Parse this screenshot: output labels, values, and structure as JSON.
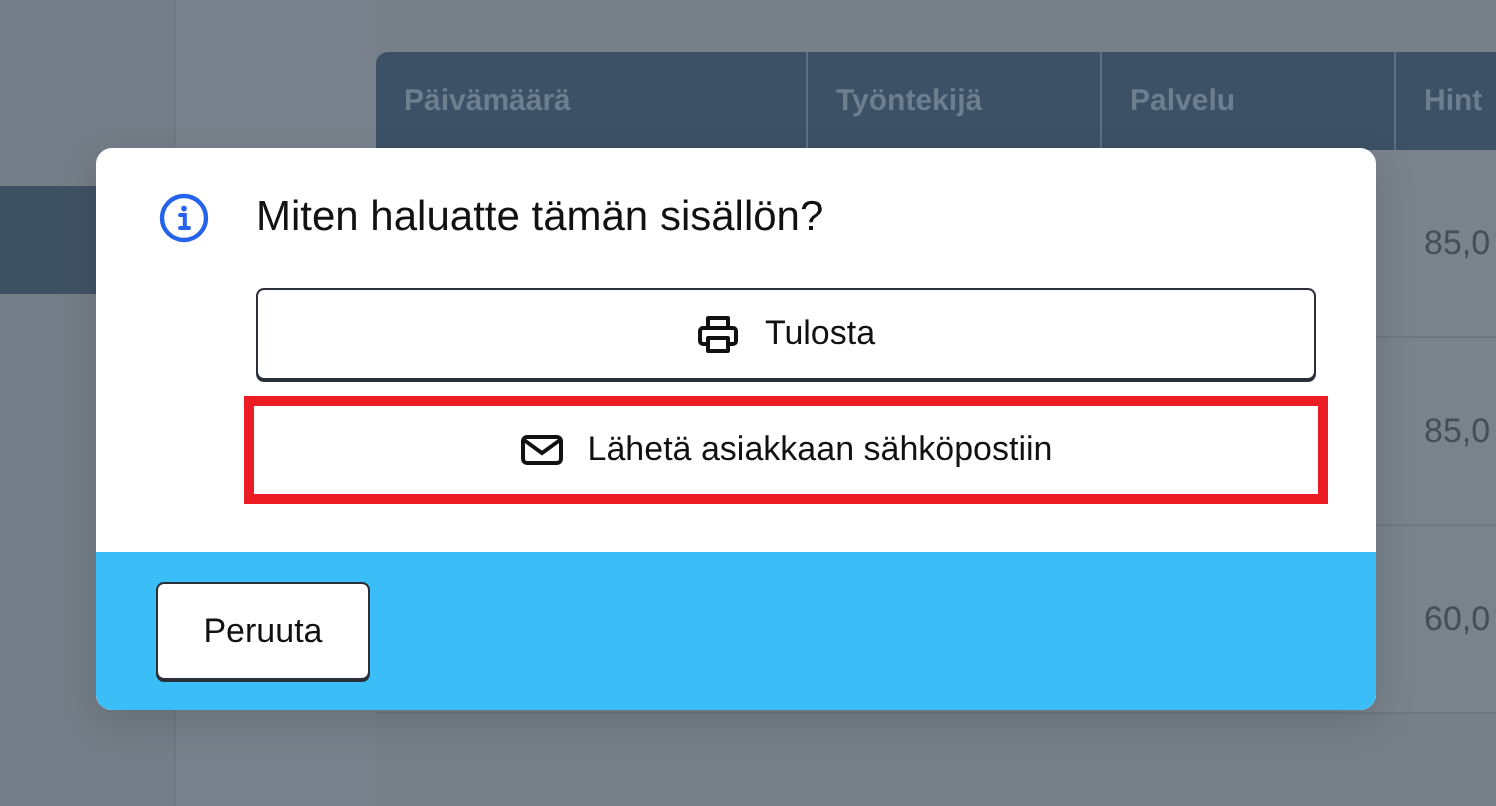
{
  "table": {
    "columns": [
      "Päivämäärä",
      "Työntekijä",
      "Palvelu",
      "Hint"
    ],
    "rows": [
      {
        "column_4": "85,0"
      },
      {
        "column_4": "85,0"
      },
      {
        "column_4": "60,0"
      }
    ]
  },
  "dialog": {
    "title": "Miten haluatte tämän sisällön?",
    "options": [
      {
        "kind": "print",
        "label": "Tulosta",
        "highlighted": false
      },
      {
        "kind": "mail",
        "label": "Lähetä asiakkaan sähköpostiin",
        "highlighted": true
      }
    ],
    "cancel": "Peruuta"
  }
}
